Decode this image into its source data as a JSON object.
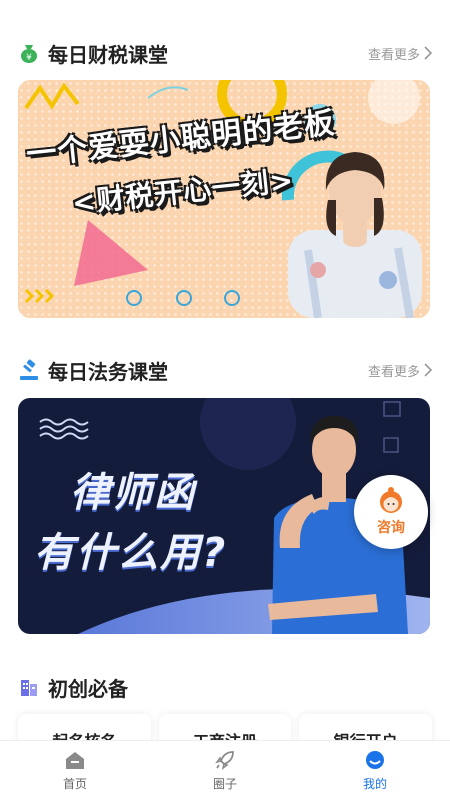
{
  "section1": {
    "title": "每日财税课堂",
    "more": "查看更多"
  },
  "banner1": {
    "line1": "一个爱耍小聪明的老板",
    "line2": "<财税开心一刻>"
  },
  "section2": {
    "title": "每日法务课堂",
    "more": "查看更多"
  },
  "banner2": {
    "line1": "律师函",
    "line2": "有什么用?"
  },
  "consult": {
    "label": "咨询"
  },
  "section3": {
    "title": "初创必备"
  },
  "cards": [
    "起名核名",
    "工商注册",
    "银行开户"
  ],
  "tabs": [
    {
      "label": "首页",
      "icon": "home-icon",
      "active": false
    },
    {
      "label": "圈子",
      "icon": "rocket-icon",
      "active": false
    },
    {
      "label": "我的",
      "icon": "profile-icon",
      "active": true
    }
  ],
  "colors": {
    "accent": "#1a73e8",
    "consult": "#f07a2a",
    "banner1_bg": "#fbd4b0",
    "banner2_bg": "#141c3b"
  }
}
